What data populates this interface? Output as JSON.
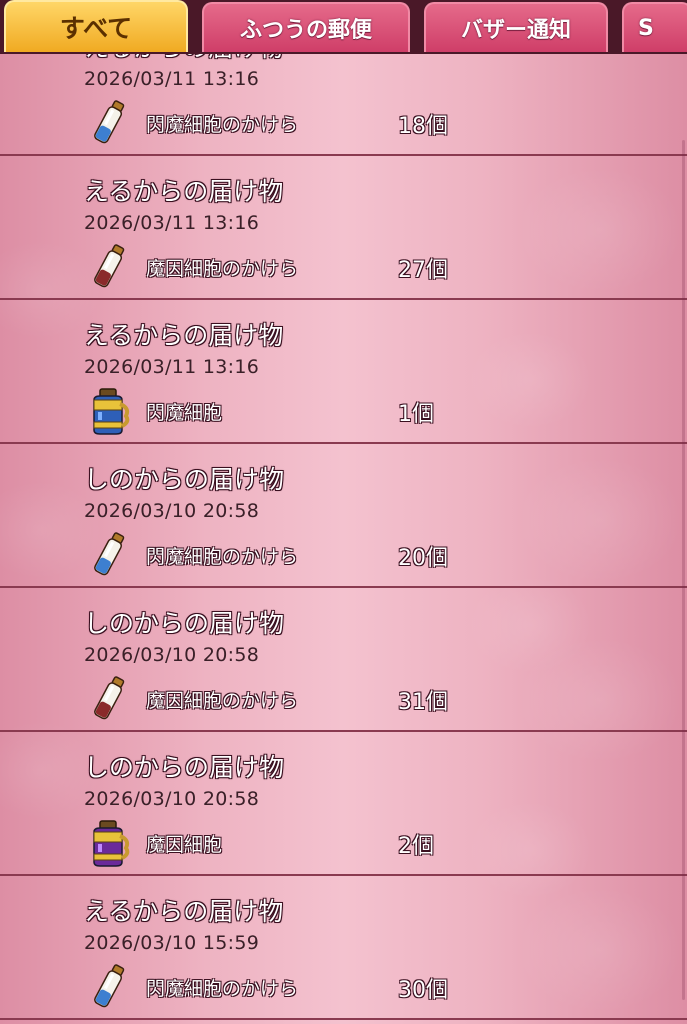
{
  "tabs": [
    {
      "label": "すべて",
      "active": true
    },
    {
      "label": "ふつうの郵便",
      "active": false
    },
    {
      "label": "バザー通知",
      "active": false
    },
    {
      "label": "S",
      "active": false
    }
  ],
  "rows": [
    {
      "title": "えるからの届け物",
      "date": "2026/03/11  13:16",
      "item": "閃魔細胞のかけら",
      "count": "18個",
      "icon": "vial-icon"
    },
    {
      "title": "えるからの届け物",
      "date": "2026/03/11  13:16",
      "item": "魔因細胞のかけら",
      "count": "27個",
      "icon": "vial-icon"
    },
    {
      "title": "えるからの届け物",
      "date": "2026/03/11  13:16",
      "item": "閃魔細胞",
      "count": "1個",
      "icon": "blue-jar-icon"
    },
    {
      "title": "しのからの届け物",
      "date": "2026/03/10  20:58",
      "item": "閃魔細胞のかけら",
      "count": "20個",
      "icon": "vial-icon"
    },
    {
      "title": "しのからの届け物",
      "date": "2026/03/10  20:58",
      "item": "魔因細胞のかけら",
      "count": "31個",
      "icon": "vial-icon"
    },
    {
      "title": "しのからの届け物",
      "date": "2026/03/10  20:58",
      "item": "魔因細胞",
      "count": "2個",
      "icon": "purple-jar-icon"
    },
    {
      "title": "えるからの届け物",
      "date": "2026/03/10  15:59",
      "item": "閃魔細胞のかけら",
      "count": "30個",
      "icon": "vial-icon"
    }
  ]
}
